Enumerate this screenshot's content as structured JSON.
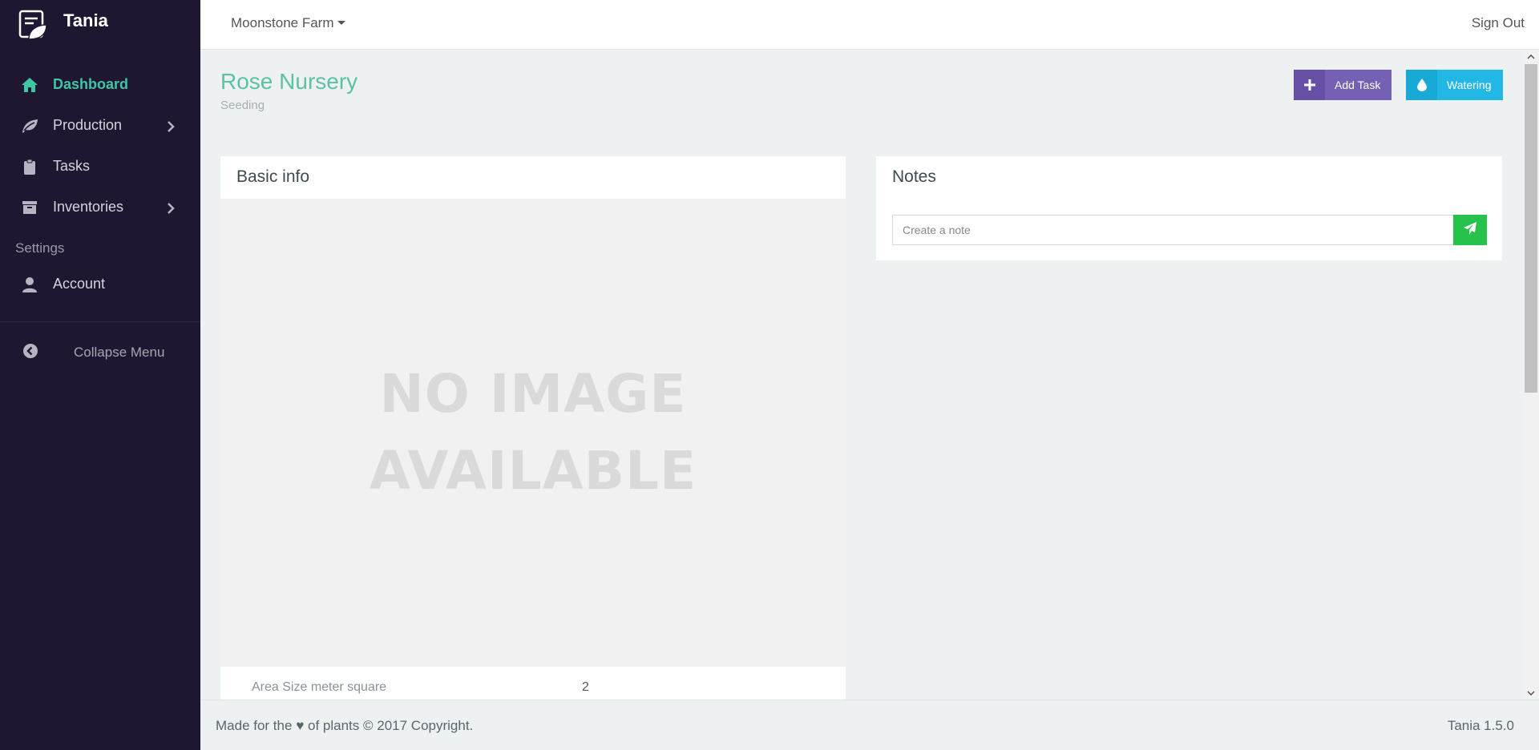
{
  "app": {
    "name": "Tania"
  },
  "sidebar": {
    "items": [
      {
        "label": "Dashboard",
        "icon": "home-icon"
      },
      {
        "label": "Production",
        "icon": "leaf-icon"
      },
      {
        "label": "Tasks",
        "icon": "clipboard-icon"
      },
      {
        "label": "Inventories",
        "icon": "archive-icon"
      }
    ],
    "settings_heading": "Settings",
    "settings_items": [
      {
        "label": "Account",
        "icon": "user-icon"
      }
    ],
    "collapse_label": "Collapse Menu"
  },
  "header": {
    "farm_selector": "Moonstone Farm",
    "sign_out": "Sign Out"
  },
  "page": {
    "title": "Rose Nursery",
    "subtitle": "Seeding",
    "buttons": {
      "add_task": "Add Task",
      "watering": "Watering"
    }
  },
  "basic_info": {
    "heading": "Basic info",
    "no_image_line1": "NO IMAGE",
    "no_image_line2": "AVAILABLE",
    "rows": [
      {
        "key": "Area Size meter square",
        "value": "2"
      }
    ]
  },
  "notes": {
    "heading": "Notes",
    "input_placeholder": "Create a note"
  },
  "footer": {
    "left_prefix": "Made for the",
    "heart": "♥",
    "left_suffix": "of plants © 2017 Copyright.",
    "version": "Tania 1.5.0"
  },
  "colors": {
    "sidebar_bg": "#1f1732",
    "accent_green": "#3ec6a4",
    "add_task_purple": "#7461b3",
    "watering_blue": "#23b7e5",
    "send_green": "#27c24c"
  }
}
